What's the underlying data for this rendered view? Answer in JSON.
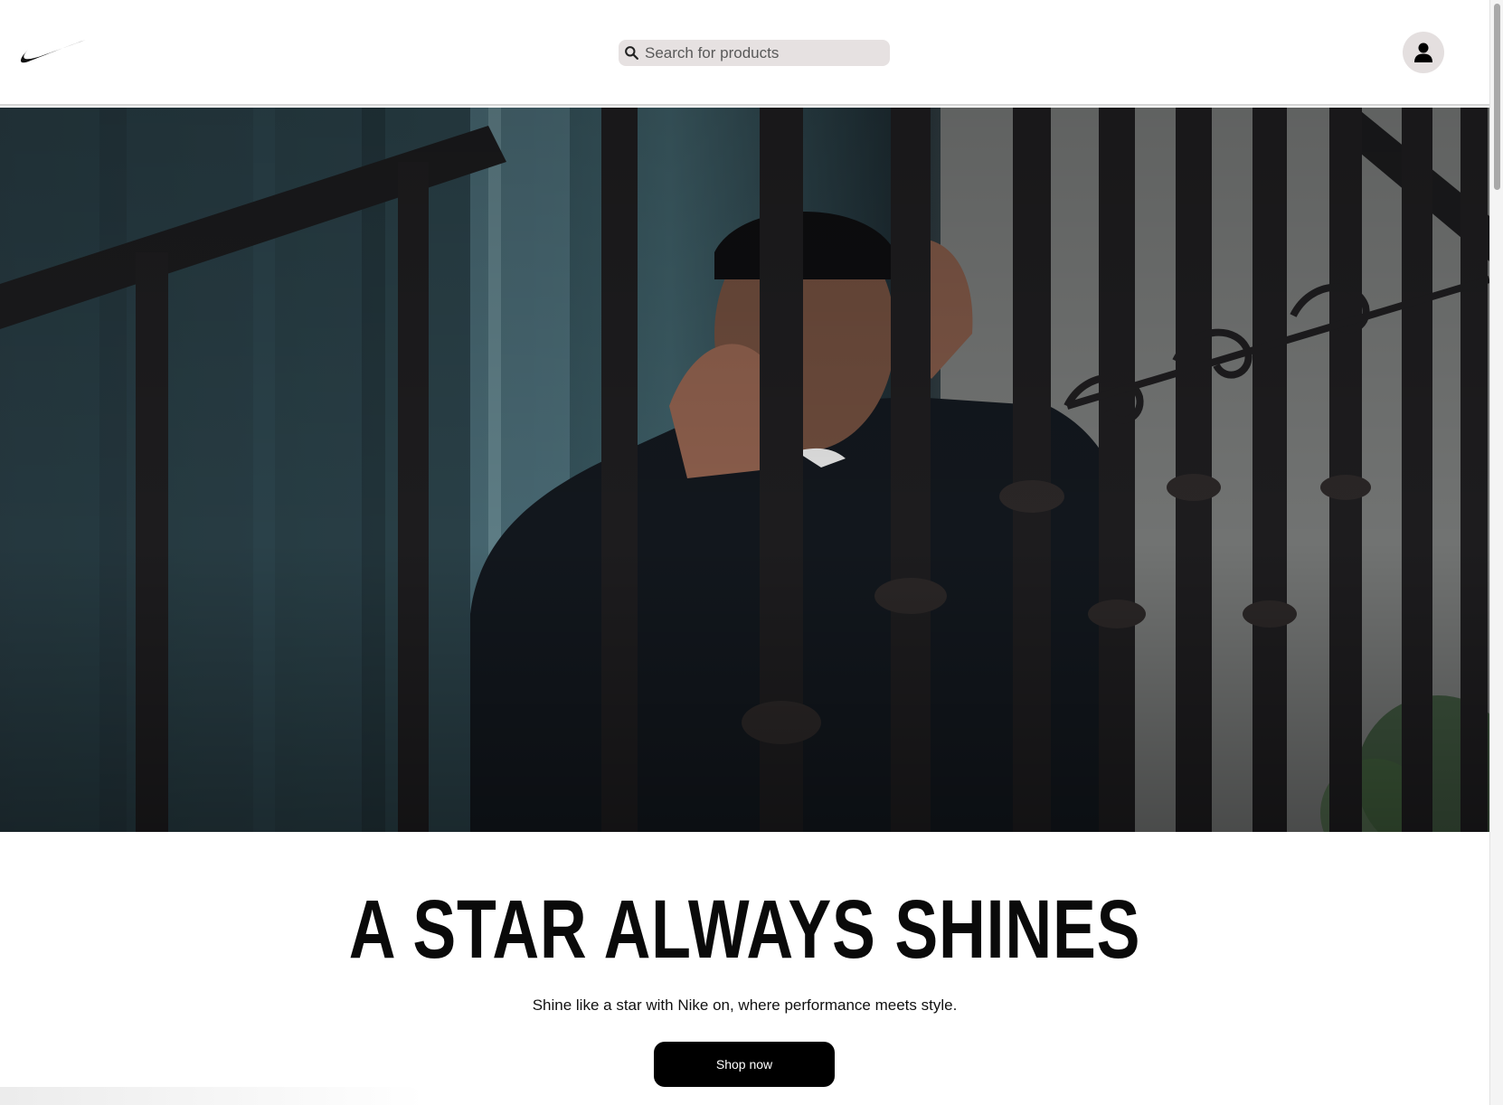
{
  "header": {
    "brand": "Nike",
    "search": {
      "placeholder": "Search for products",
      "value": ""
    },
    "icons": {
      "logo": "nike-swoosh-icon",
      "search": "search-icon",
      "account": "user-icon"
    }
  },
  "hero": {
    "media": "video-still",
    "alt": "A person in dark clothing covering their ear, standing behind black wrought-iron railings"
  },
  "content": {
    "headline": "A STAR ALWAYS SHINES",
    "subtitle": "Shine like a star with Nike on, where performance meets style.",
    "cta_label": "Shop now"
  },
  "colors": {
    "header_bg": "#ffffff",
    "search_bg": "#e6e1e1",
    "avatar_bg": "#e4dfdf",
    "button_bg": "#000000",
    "button_text": "#ffffff"
  }
}
